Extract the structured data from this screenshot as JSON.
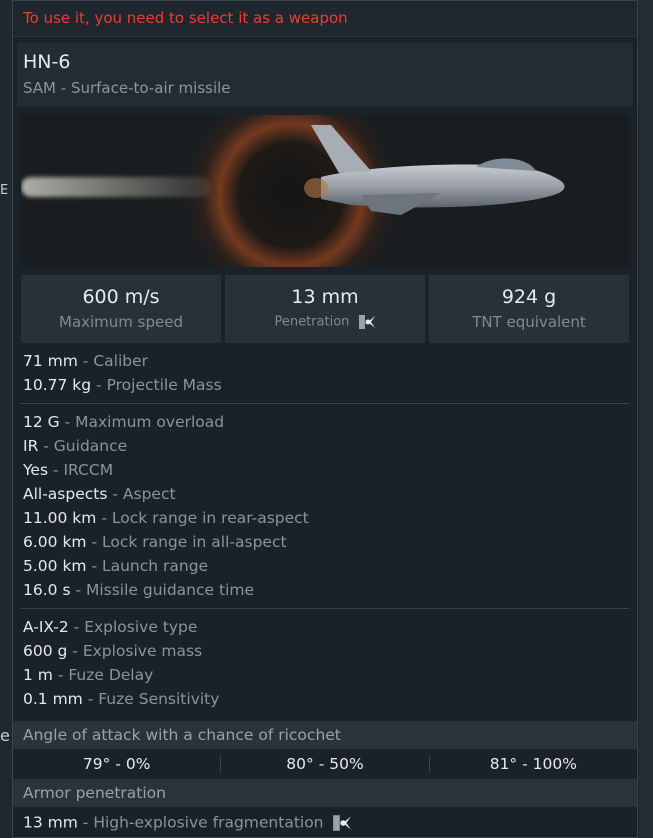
{
  "warning": "To use it, you need to select it as a weapon",
  "weapon": {
    "name": "HN-6",
    "type": "SAM - Surface-to-air missile"
  },
  "stats": [
    {
      "value": "600 m/s",
      "label": "Maximum speed"
    },
    {
      "value": "13 mm",
      "label": "Penetration",
      "icon": "penetration-burst-icon"
    },
    {
      "value": "924 g",
      "label": "TNT equivalent"
    }
  ],
  "basic": [
    {
      "value": "71 mm",
      "label": "Caliber"
    },
    {
      "value": "10.77 kg",
      "label": "Projectile Mass"
    }
  ],
  "guidance": [
    {
      "value": "12 G",
      "label": "Maximum overload"
    },
    {
      "value": "IR",
      "label": "Guidance"
    },
    {
      "value": "Yes",
      "label": "IRCCM"
    },
    {
      "value": "All-aspects",
      "label": "Aspect"
    },
    {
      "value": "11.00 km",
      "label": "Lock range in rear-aspect"
    },
    {
      "value": "6.00 km",
      "label": "Lock range in all-aspect"
    },
    {
      "value": "5.00 km",
      "label": "Launch range"
    },
    {
      "value": "16.0 s",
      "label": "Missile guidance time"
    }
  ],
  "explosive": [
    {
      "value": "A-IX-2",
      "label": "Explosive type"
    },
    {
      "value": "600 g",
      "label": "Explosive mass"
    },
    {
      "value": "1 m",
      "label": "Fuze Delay"
    },
    {
      "value": "0.1 mm",
      "label": "Fuze Sensitivity"
    }
  ],
  "ricochet": {
    "title": "Angle of attack with a chance of ricochet",
    "values": [
      "79° - 0%",
      "80° - 50%",
      "81° - 100%"
    ]
  },
  "armor": {
    "title": "Armor penetration",
    "value": "13 mm",
    "label": "High-explosive fragmentation",
    "icon": "penetration-burst-icon"
  },
  "background_edge": {
    "items": [
      "E",
      "e"
    ]
  },
  "colors": {
    "warning": "#ee3b32",
    "value": "#e6e9ec",
    "label": "#8a949c",
    "panel": "#1a2229"
  }
}
